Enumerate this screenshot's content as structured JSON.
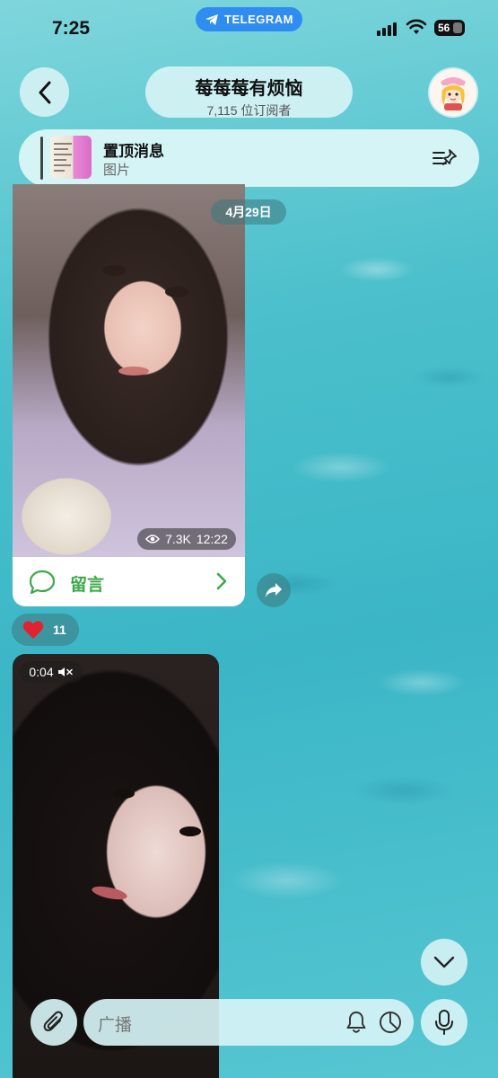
{
  "status_bar": {
    "time": "7:25",
    "app_pill": "TELEGRAM",
    "battery": "56"
  },
  "header": {
    "channel_name": "莓莓莓有烦恼",
    "subscribers": "7,115 位订阅者"
  },
  "pinned": {
    "title": "置顶消息",
    "subtitle": "图片"
  },
  "feed": {
    "date_label": "4月29日",
    "post1": {
      "views": "7.3K",
      "time": "12:22",
      "comment_label": "留言",
      "reaction_emoji": "heart",
      "reaction_count": "11"
    },
    "post2": {
      "duration": "0:04"
    }
  },
  "composer": {
    "placeholder": "广播"
  },
  "colors": {
    "accent_blue": "#2f8cf0",
    "comment_green": "#3da84a",
    "heart_red": "#e0242f"
  },
  "icons": [
    "back-icon",
    "pin-list-icon",
    "eye-icon",
    "comment-icon",
    "chevron-right-icon",
    "share-icon",
    "heart-icon",
    "mute-icon",
    "chevron-down-icon",
    "paperclip-icon",
    "bell-icon",
    "timer-icon",
    "mic-icon"
  ]
}
